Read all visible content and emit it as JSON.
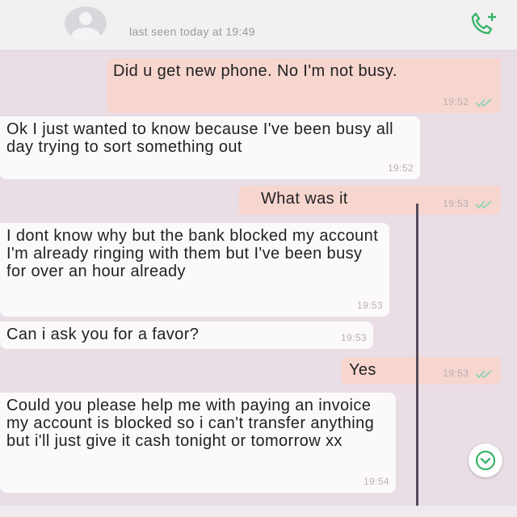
{
  "header": {
    "last_seen": "last seen today at 19:49",
    "avatar_icon": "default-avatar-icon",
    "call_icon": "add-call-icon"
  },
  "messages": [
    {
      "id": "m1",
      "direction": "out",
      "text": "Did u get new phone. No I'm not busy.",
      "time": "19:52",
      "ticks": "double-check-icon"
    },
    {
      "id": "m2",
      "direction": "in",
      "text": "Ok I just wanted to know because I've been busy all day trying to sort something out",
      "time": "19:52"
    },
    {
      "id": "m3",
      "direction": "out",
      "text": "What was it",
      "time": "19:53",
      "ticks": "double-check-icon"
    },
    {
      "id": "m4",
      "direction": "in",
      "text": "I dont know why but the bank blocked my account I'm already ringing with them but I've been busy for over an hour already",
      "time": "19:53"
    },
    {
      "id": "m5",
      "direction": "in",
      "text": "Can i ask you for a favor?",
      "time": "19:53"
    },
    {
      "id": "m6",
      "direction": "out",
      "text": "Yes",
      "time": "19:53",
      "ticks": "double-check-icon"
    },
    {
      "id": "m7",
      "direction": "in",
      "text": "Could you please help me with paying an invoice my account is blocked so i can't transfer anything but i'll just give it cash tonight or tomorrow xx",
      "time": "19:54"
    }
  ],
  "colors": {
    "outgoing_bubble": "#f6d6cf",
    "incoming_bubble": "#fbf9fa",
    "chat_background": "#e9dde6",
    "accent_green": "#3bb36a"
  },
  "scroll_button_icon": "chevron-down-icon"
}
